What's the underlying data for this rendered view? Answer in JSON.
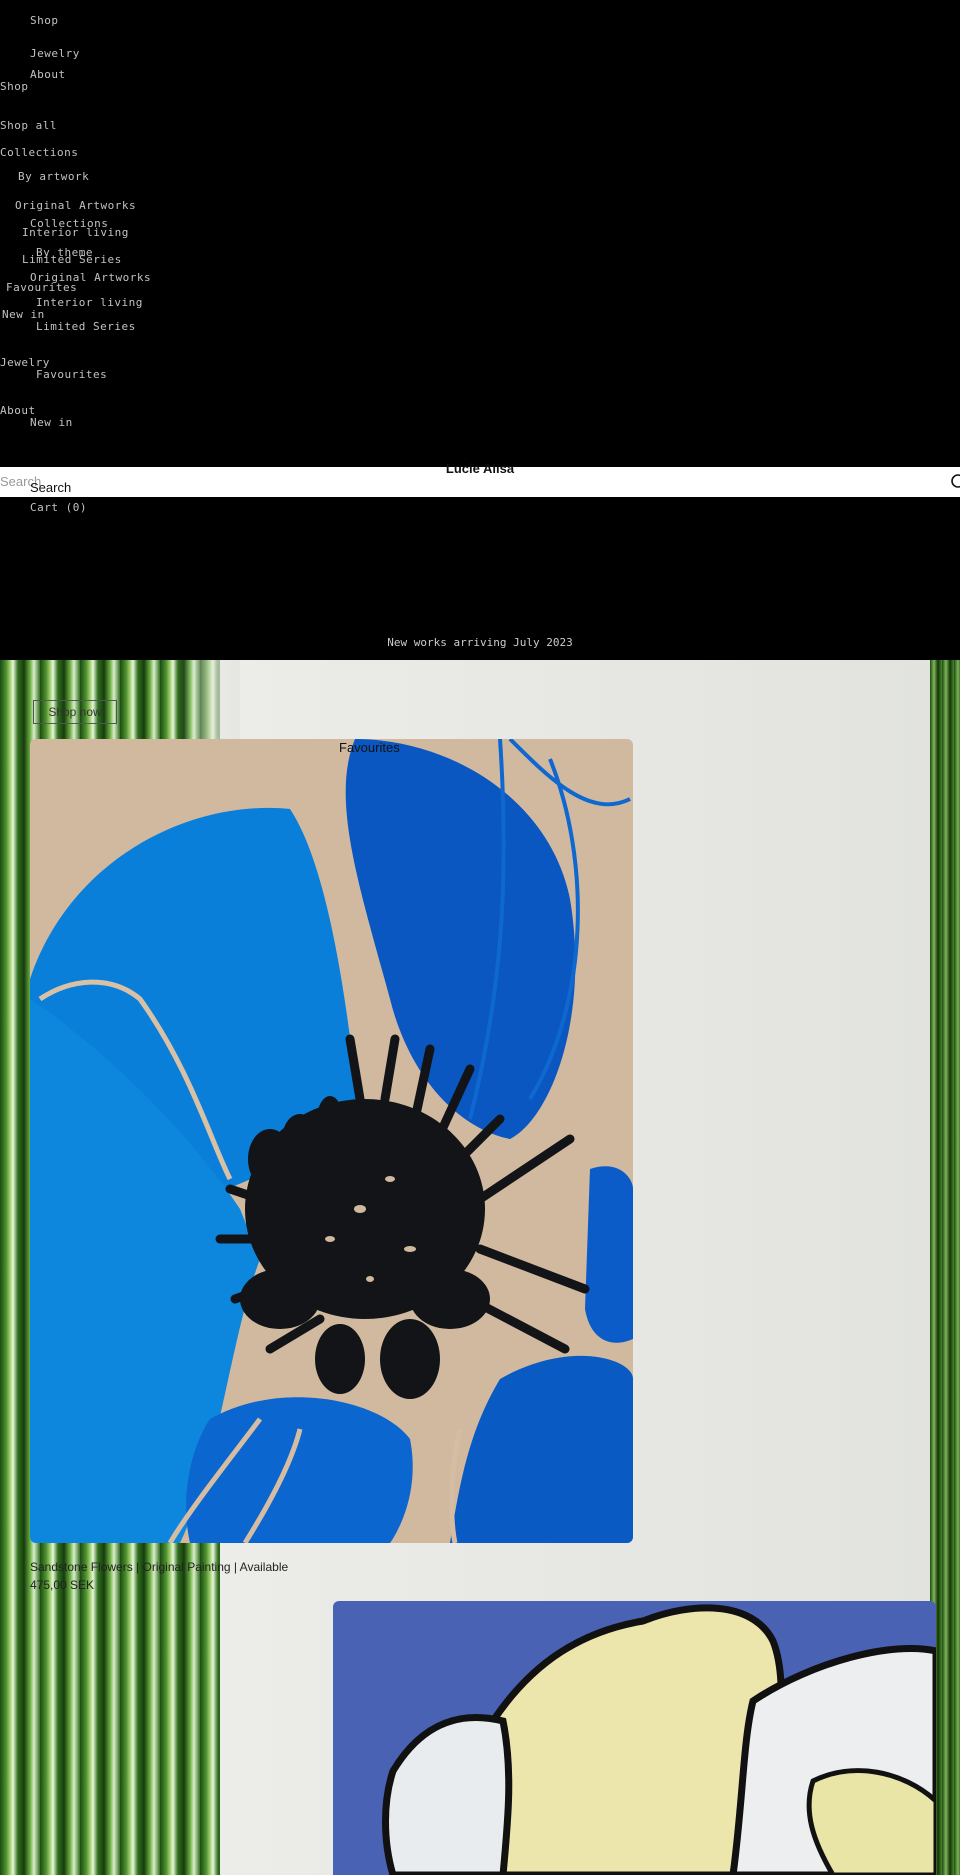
{
  "nav": {
    "lines": [
      "Shop",
      "Jewelry",
      "About",
      "Shop",
      "Shop all",
      "Collections",
      "By artwork",
      "Original Artworks",
      "Collections",
      "Interior living",
      "By theme",
      "Limited Series",
      "Original Artworks",
      "Favourites",
      "Interior living",
      "New in",
      "Limited Series",
      "Jewelry",
      "Favourites",
      "About",
      "New in"
    ]
  },
  "header": {
    "brand": "Lucie Alisa",
    "search_placeholder": "Search",
    "search_label": "Search",
    "cart_label": "Cart (0)"
  },
  "banner": {
    "text": "New works arriving July 2023"
  },
  "hero": {
    "shop_now_label": "Shop now",
    "section_title": "Favourites"
  },
  "products": [
    {
      "title": "Sandstone Flowers | Original Painting | Available",
      "price": "475,00 SEK"
    }
  ],
  "colors": {
    "page_bg": "#000000",
    "header_bg": "#ffffff",
    "hero_bg": "#e6e6e2",
    "flower_blue": "#0a7fd9",
    "flower_dark_blue": "#0a57c2",
    "card_bg_blue": "#4a62b4"
  }
}
